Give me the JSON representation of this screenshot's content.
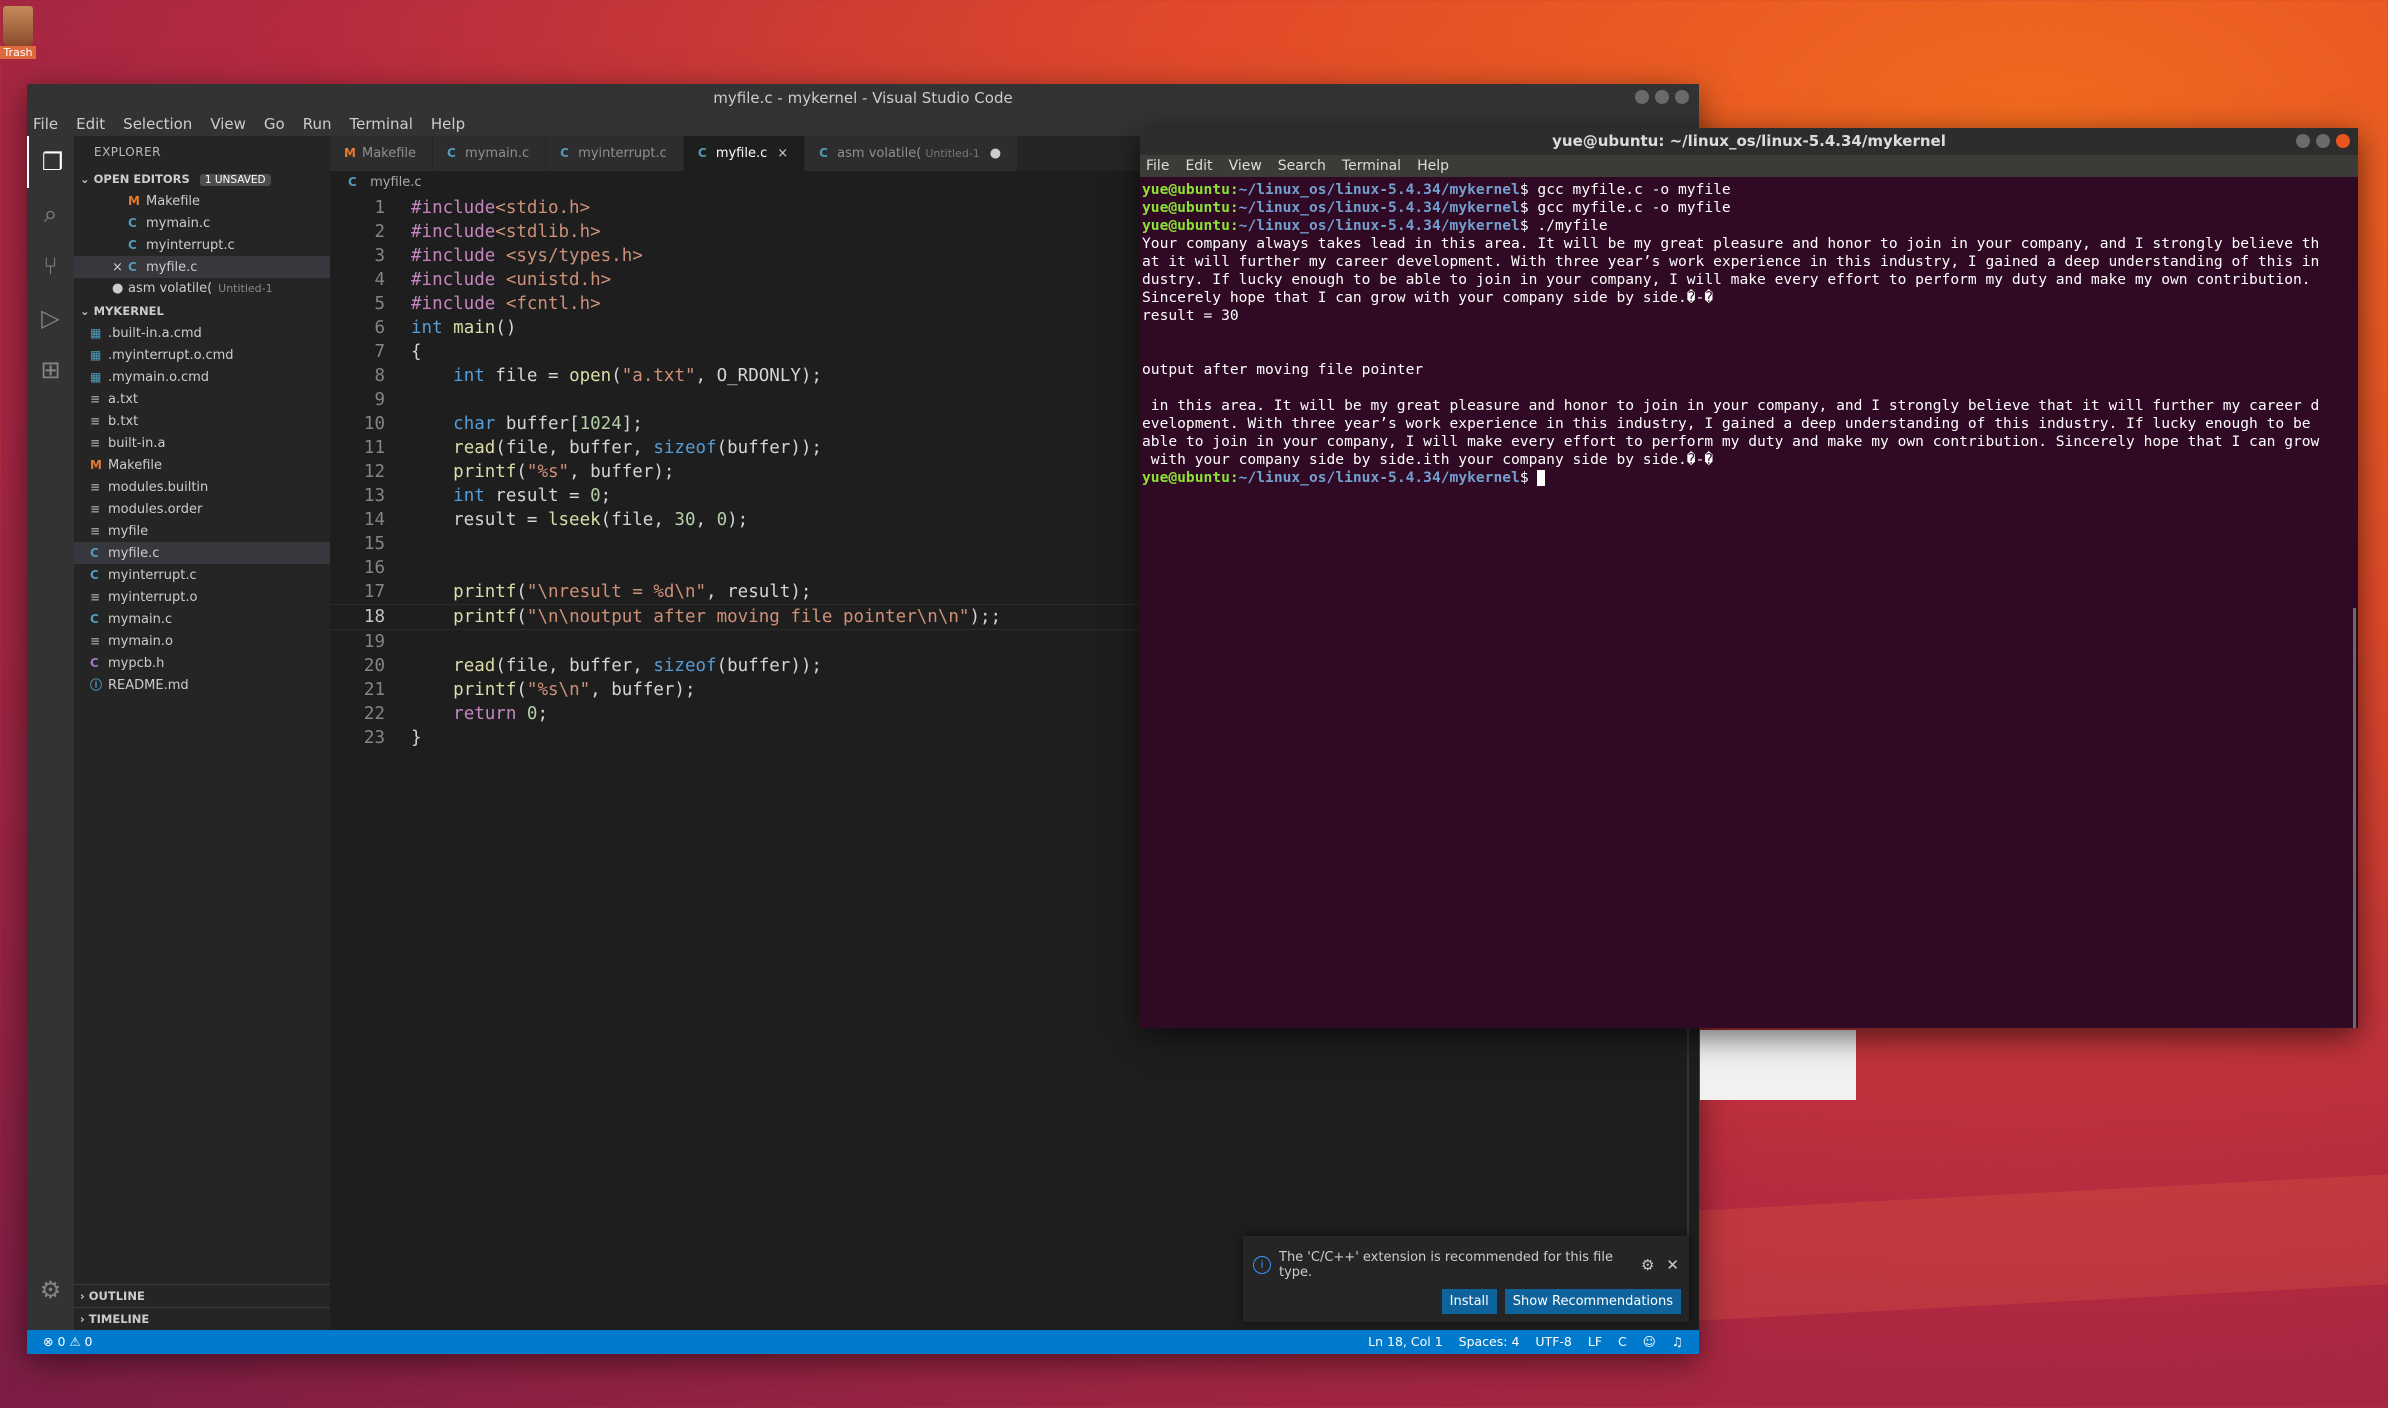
{
  "desktop": {
    "trash_label": "Trash"
  },
  "vscode": {
    "title": "myfile.c - mykernel - Visual Studio Code",
    "menu": [
      "File",
      "Edit",
      "Selection",
      "View",
      "Go",
      "Run",
      "Terminal",
      "Help"
    ],
    "explorer": {
      "title": "EXPLORER",
      "open_editors_label": "OPEN EDITORS",
      "unsaved_badge": "1 UNSAVED",
      "open_editors": [
        {
          "name": "Makefile",
          "icon": "M",
          "type": "make",
          "mark": "",
          "sub": ""
        },
        {
          "name": "mymain.c",
          "icon": "C",
          "type": "c",
          "mark": "",
          "sub": ""
        },
        {
          "name": "myinterrupt.c",
          "icon": "C",
          "type": "c",
          "mark": "",
          "sub": ""
        },
        {
          "name": "myfile.c",
          "icon": "C",
          "type": "c",
          "mark": "×",
          "sub": "",
          "active": true
        },
        {
          "name": "asm volatile(",
          "icon": "",
          "type": "text",
          "mark": "●",
          "sub": "Untitled-1"
        }
      ],
      "folder_label": "MYKERNEL",
      "files": [
        {
          "name": ".built-in.a.cmd",
          "type": "cmd"
        },
        {
          "name": ".myinterrupt.o.cmd",
          "type": "cmd"
        },
        {
          "name": ".mymain.o.cmd",
          "type": "cmd"
        },
        {
          "name": "a.txt",
          "type": "text"
        },
        {
          "name": "b.txt",
          "type": "text"
        },
        {
          "name": "built-in.a",
          "type": "text"
        },
        {
          "name": "Makefile",
          "type": "make"
        },
        {
          "name": "modules.builtin",
          "type": "text"
        },
        {
          "name": "modules.order",
          "type": "text"
        },
        {
          "name": "myfile",
          "type": "text"
        },
        {
          "name": "myfile.c",
          "type": "c",
          "active": true
        },
        {
          "name": "myinterrupt.c",
          "type": "c"
        },
        {
          "name": "myinterrupt.o",
          "type": "text"
        },
        {
          "name": "mymain.c",
          "type": "c"
        },
        {
          "name": "mymain.o",
          "type": "text"
        },
        {
          "name": "mypcb.h",
          "type": "h"
        },
        {
          "name": "README.md",
          "type": "info"
        }
      ],
      "outline_label": "OUTLINE",
      "timeline_label": "TIMELINE"
    },
    "tabs": [
      {
        "label": "Makefile",
        "icon": "M",
        "type": "make"
      },
      {
        "label": "mymain.c",
        "icon": "C",
        "type": "c"
      },
      {
        "label": "myinterrupt.c",
        "icon": "C",
        "type": "c"
      },
      {
        "label": "myfile.c",
        "icon": "C",
        "type": "c",
        "active": true,
        "close": "×"
      },
      {
        "label": "asm volatile(",
        "icon": "C",
        "type": "c",
        "sub": "Untitled-1",
        "dot": "●"
      }
    ],
    "breadcrumb": "myfile.c",
    "code_lines": [
      [
        {
          "t": "#include",
          "c": "#c586c0"
        },
        {
          "t": "<stdio.h>",
          "c": "#ce9178"
        }
      ],
      [
        {
          "t": "#include",
          "c": "#c586c0"
        },
        {
          "t": "<stdlib.h>",
          "c": "#ce9178"
        }
      ],
      [
        {
          "t": "#include ",
          "c": "#c586c0"
        },
        {
          "t": "<sys/types.h>",
          "c": "#ce9178"
        }
      ],
      [
        {
          "t": "#include ",
          "c": "#c586c0"
        },
        {
          "t": "<unistd.h>",
          "c": "#ce9178"
        }
      ],
      [
        {
          "t": "#include ",
          "c": "#c586c0"
        },
        {
          "t": "<fcntl.h>",
          "c": "#ce9178"
        }
      ],
      [
        {
          "t": "int",
          "c": "#569cd6"
        },
        {
          "t": " ",
          "c": "#d4d4d4"
        },
        {
          "t": "main",
          "c": "#dcdcaa"
        },
        {
          "t": "()",
          "c": "#d4d4d4"
        }
      ],
      [
        {
          "t": "{",
          "c": "#d4d4d4"
        }
      ],
      [
        {
          "t": "    ",
          "c": "#d4d4d4"
        },
        {
          "t": "int",
          "c": "#569cd6"
        },
        {
          "t": " file = ",
          "c": "#d4d4d4"
        },
        {
          "t": "open",
          "c": "#dcdcaa"
        },
        {
          "t": "(",
          "c": "#d4d4d4"
        },
        {
          "t": "\"a.txt\"",
          "c": "#ce9178"
        },
        {
          "t": ", O_RDONLY);",
          "c": "#d4d4d4"
        }
      ],
      [],
      [
        {
          "t": "    ",
          "c": "#d4d4d4"
        },
        {
          "t": "char",
          "c": "#569cd6"
        },
        {
          "t": " buffer[",
          "c": "#d4d4d4"
        },
        {
          "t": "1024",
          "c": "#b5cea8"
        },
        {
          "t": "];",
          "c": "#d4d4d4"
        }
      ],
      [
        {
          "t": "    ",
          "c": "#d4d4d4"
        },
        {
          "t": "read",
          "c": "#dcdcaa"
        },
        {
          "t": "(file, buffer, ",
          "c": "#d4d4d4"
        },
        {
          "t": "sizeof",
          "c": "#569cd6"
        },
        {
          "t": "(buffer));",
          "c": "#d4d4d4"
        }
      ],
      [
        {
          "t": "    ",
          "c": "#d4d4d4"
        },
        {
          "t": "printf",
          "c": "#dcdcaa"
        },
        {
          "t": "(",
          "c": "#d4d4d4"
        },
        {
          "t": "\"%s\"",
          "c": "#ce9178"
        },
        {
          "t": ", buffer);",
          "c": "#d4d4d4"
        }
      ],
      [
        {
          "t": "    ",
          "c": "#d4d4d4"
        },
        {
          "t": "int",
          "c": "#569cd6"
        },
        {
          "t": " result = ",
          "c": "#d4d4d4"
        },
        {
          "t": "0",
          "c": "#b5cea8"
        },
        {
          "t": ";",
          "c": "#d4d4d4"
        }
      ],
      [
        {
          "t": "    result = ",
          "c": "#d4d4d4"
        },
        {
          "t": "lseek",
          "c": "#dcdcaa"
        },
        {
          "t": "(file, ",
          "c": "#d4d4d4"
        },
        {
          "t": "30",
          "c": "#b5cea8"
        },
        {
          "t": ", ",
          "c": "#d4d4d4"
        },
        {
          "t": "0",
          "c": "#b5cea8"
        },
        {
          "t": ");",
          "c": "#d4d4d4"
        }
      ],
      [],
      [],
      [
        {
          "t": "    ",
          "c": "#d4d4d4"
        },
        {
          "t": "printf",
          "c": "#dcdcaa"
        },
        {
          "t": "(",
          "c": "#d4d4d4"
        },
        {
          "t": "\"\\nresult = %d\\n\"",
          "c": "#ce9178"
        },
        {
          "t": ", result);",
          "c": "#d4d4d4"
        }
      ],
      [
        {
          "t": "    ",
          "c": "#d4d4d4"
        },
        {
          "t": "printf",
          "c": "#dcdcaa"
        },
        {
          "t": "(",
          "c": "#d4d4d4"
        },
        {
          "t": "\"\\n\\noutput after moving file pointer\\n\\n\"",
          "c": "#ce9178"
        },
        {
          "t": ");;",
          "c": "#d4d4d4"
        }
      ],
      [],
      [
        {
          "t": "    ",
          "c": "#d4d4d4"
        },
        {
          "t": "read",
          "c": "#dcdcaa"
        },
        {
          "t": "(file, buffer, ",
          "c": "#d4d4d4"
        },
        {
          "t": "sizeof",
          "c": "#569cd6"
        },
        {
          "t": "(buffer));",
          "c": "#d4d4d4"
        }
      ],
      [
        {
          "t": "    ",
          "c": "#d4d4d4"
        },
        {
          "t": "printf",
          "c": "#dcdcaa"
        },
        {
          "t": "(",
          "c": "#d4d4d4"
        },
        {
          "t": "\"%s\\n\"",
          "c": "#ce9178"
        },
        {
          "t": ", buffer);",
          "c": "#d4d4d4"
        }
      ],
      [
        {
          "t": "    ",
          "c": "#d4d4d4"
        },
        {
          "t": "return",
          "c": "#c586c0"
        },
        {
          "t": " ",
          "c": "#d4d4d4"
        },
        {
          "t": "0",
          "c": "#b5cea8"
        },
        {
          "t": ";",
          "c": "#d4d4d4"
        }
      ],
      [
        {
          "t": "}",
          "c": "#d4d4d4"
        }
      ]
    ],
    "current_line": 18,
    "notification": {
      "message": "The 'C/C++' extension is recommended for this file type.",
      "install_label": "Install",
      "show_label": "Show Recommendations"
    },
    "status": {
      "problems": "⊗ 0 ⚠ 0",
      "position": "Ln 18, Col 1",
      "spaces": "Spaces: 4",
      "encoding": "UTF-8",
      "eol": "LF",
      "language": "C"
    }
  },
  "terminal": {
    "title": "yue@ubuntu: ~/linux_os/linux-5.4.34/mykernel",
    "menu": [
      "File",
      "Edit",
      "View",
      "Search",
      "Terminal",
      "Help"
    ],
    "lines": [
      {
        "user": "yue@ubuntu",
        "path": "~/linux_os/linux-5.4.34/mykernel",
        "cmd": "$ gcc myfile.c -o myfile"
      },
      {
        "user": "yue@ubuntu",
        "path": "~/linux_os/linux-5.4.34/mykernel",
        "cmd": "$ gcc myfile.c -o myfile"
      },
      {
        "user": "yue@ubuntu",
        "path": "~/linux_os/linux-5.4.34/mykernel",
        "cmd": "$ ./myfile"
      },
      {
        "text": "Your company always takes lead in this area. It will be my great pleasure and honor to join in your company, and I strongly believe th"
      },
      {
        "text": "at it will further my career development. With three year’s work experience in this industry, I gained a deep understanding of this in"
      },
      {
        "text": "dustry. If lucky enough to be able to join in your company, I will make every effort to perform my duty and make my own contribution."
      },
      {
        "text": "Sincerely hope that I can grow with your company side by side.�-�"
      },
      {
        "text": "result = 30"
      },
      {
        "text": ""
      },
      {
        "text": ""
      },
      {
        "text": "output after moving file pointer"
      },
      {
        "text": ""
      },
      {
        "text": " in this area. It will be my great pleasure and honor to join in your company, and I strongly believe that it will further my career d"
      },
      {
        "text": "evelopment. With three year’s work experience in this industry, I gained a deep understanding of this industry. If lucky enough to be"
      },
      {
        "text": "able to join in your company, I will make every effort to perform my duty and make my own contribution. Sincerely hope that I can grow"
      },
      {
        "text": " with your company side by side.ith your company side by side.�-�"
      },
      {
        "user": "yue@ubuntu",
        "path": "~/linux_os/linux-5.4.34/mykernel",
        "cmd": "$ ",
        "cursor": true
      }
    ]
  }
}
